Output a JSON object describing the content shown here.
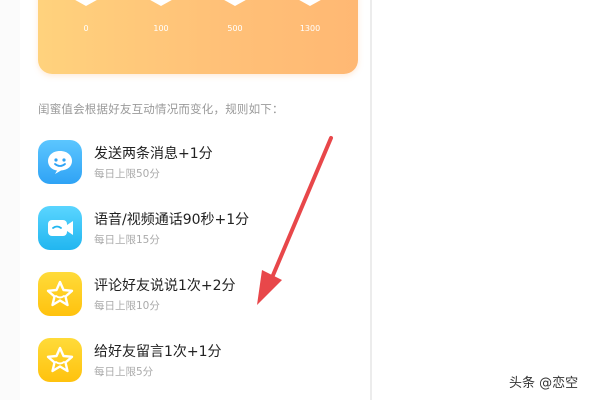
{
  "milestones": [
    "0",
    "100",
    "500",
    "1300"
  ],
  "rules_intro": "闺蜜值会根据好友互动情况而变化，规则如下：",
  "rules": [
    {
      "title": "发送两条消息+1分",
      "limit": "每日上限50分",
      "icon": "chat-smile-icon"
    },
    {
      "title": "语音/视频通话90秒+1分",
      "limit": "每日上限15分",
      "icon": "video-call-icon"
    },
    {
      "title": "评论好友说说1次+2分",
      "limit": "每日上限10分",
      "icon": "star-icon"
    },
    {
      "title": "给好友留言1次+1分",
      "limit": "每日上限5分",
      "icon": "star-icon"
    }
  ],
  "watermark": "头条 @恋空",
  "colors": {
    "card_orange": "#ffc178",
    "arrow_red": "#e8474a",
    "icon_blue": "#2fa3f5",
    "icon_yellow": "#ffc20e"
  }
}
